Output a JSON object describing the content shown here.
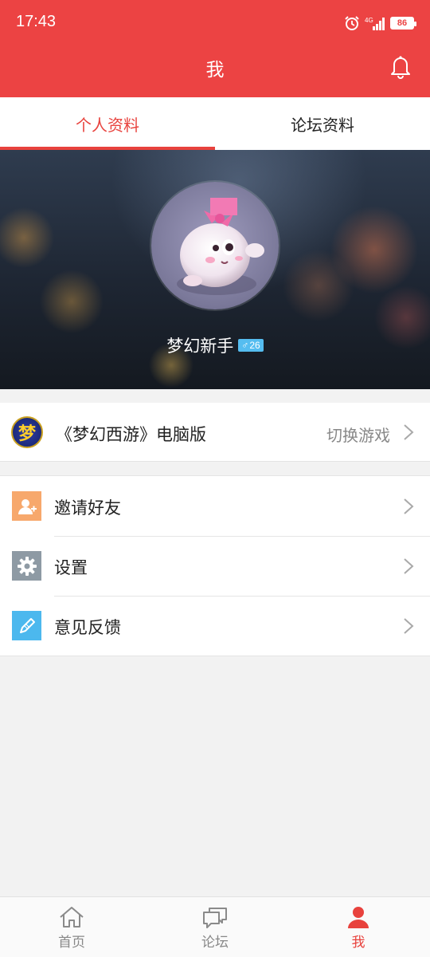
{
  "status_bar": {
    "time": "17:43",
    "network": "4G",
    "battery": "86",
    "icons": [
      "alarm-icon",
      "signal-icon",
      "battery-icon"
    ]
  },
  "header": {
    "title": "我",
    "bell_icon": "bell-icon",
    "background_color": "#ec4343"
  },
  "tabs": [
    {
      "label": "个人资料",
      "active": true
    },
    {
      "label": "论坛资料",
      "active": false
    }
  ],
  "profile": {
    "nickname": "梦幻新手",
    "gender_symbol": "♂",
    "age": "26"
  },
  "game": {
    "name": "《梦幻西游》电脑版",
    "logo_text": "梦",
    "switch_label": "切换游戏"
  },
  "menu": [
    {
      "label": "邀请好友",
      "icon": "invite-friend-icon",
      "color": "#f7a86c"
    },
    {
      "label": "设置",
      "icon": "gear-icon",
      "color": "#8e9aa4"
    },
    {
      "label": "意见反馈",
      "icon": "pencil-icon",
      "color": "#4cb8ee"
    }
  ],
  "bottom_nav": [
    {
      "label": "首页",
      "icon": "home-icon",
      "active": false
    },
    {
      "label": "论坛",
      "icon": "chat-bubbles-icon",
      "active": false
    },
    {
      "label": "我",
      "icon": "user-icon",
      "active": true
    }
  ],
  "colors": {
    "accent": "#e8423d",
    "background": "#f2f2f2"
  }
}
